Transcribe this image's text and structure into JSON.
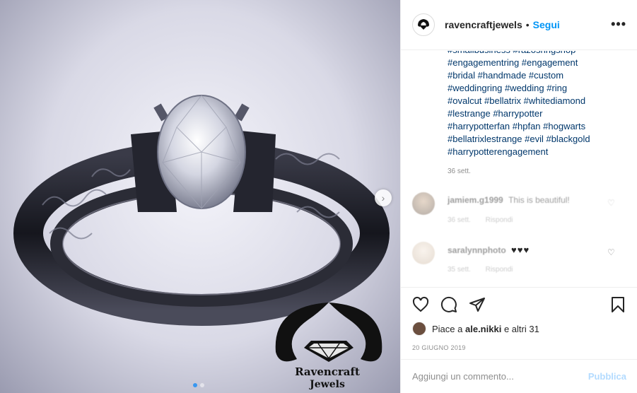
{
  "post": {
    "username": "ravencraftjewels",
    "follow_label": "Segui",
    "more_label": "•••",
    "image_logo": {
      "line1": "Ravencraft",
      "line2": "Jewels"
    }
  },
  "caption": {
    "lines": [
      "#smallbusiness #razosringshop",
      "#engagementring #engagement",
      "#bridal #handmade #custom",
      "#weddingring #wedding #ring",
      "#ovalcut #bellatrix #whitediamond",
      "#lestrange #harrypotter",
      "#harrypotterfan #hpfan #hogwarts",
      "#bellatrixlestrange #evil #blackgold",
      "#harrypotterengagement"
    ],
    "time": "36 sett."
  },
  "comments": [
    {
      "user": "jamiem.g1999",
      "text": "This is beautiful!",
      "time": "36 sett.",
      "reply": "Rispondi"
    },
    {
      "user": "saralynnphoto",
      "text": "♥♥♥",
      "time": "35 sett.",
      "reply": "Rispondi"
    }
  ],
  "likes": {
    "prefix": "Piace a",
    "user": "ale.nikki",
    "suffix": "e altri 31"
  },
  "date": "20 GIUGNO 2019",
  "comment_input": {
    "placeholder": "Aggiungi un commento...",
    "publish_label": "Pubblica"
  },
  "carousel": {
    "total": 2,
    "current": 1
  },
  "colors": {
    "link": "#00376b",
    "follow": "#0095f6",
    "publish_disabled": "#b3dbff",
    "heart": "#ed4956",
    "dot_active": "#3897f0"
  }
}
